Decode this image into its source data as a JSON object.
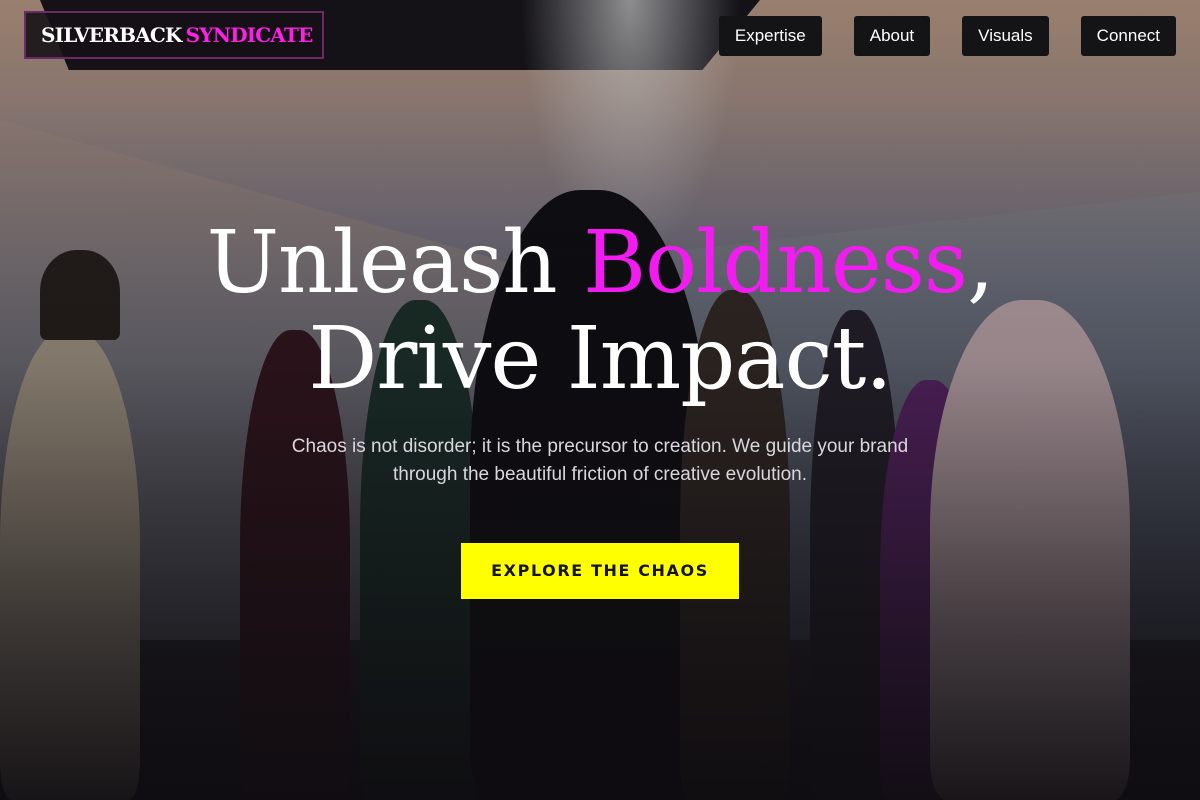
{
  "brand": {
    "name_part1": "SILVERBACK",
    "name_part2": "SYNDICATE",
    "accent_color": "#ff1fe8"
  },
  "nav": {
    "items": [
      {
        "label": "Expertise"
      },
      {
        "label": "About"
      },
      {
        "label": "Visuals"
      },
      {
        "label": "Connect"
      }
    ]
  },
  "hero": {
    "headline_part1": "Unleash ",
    "headline_accent": "Boldness",
    "headline_part2": ",",
    "headline_line2": "Drive Impact.",
    "subtext": "Chaos is not disorder; it is the precursor to creation. We guide your brand through the beautiful friction of creative evolution.",
    "cta_label": "EXPLORE THE CHAOS",
    "cta_color": "#ffff00",
    "accent_color": "#f21cf0"
  }
}
